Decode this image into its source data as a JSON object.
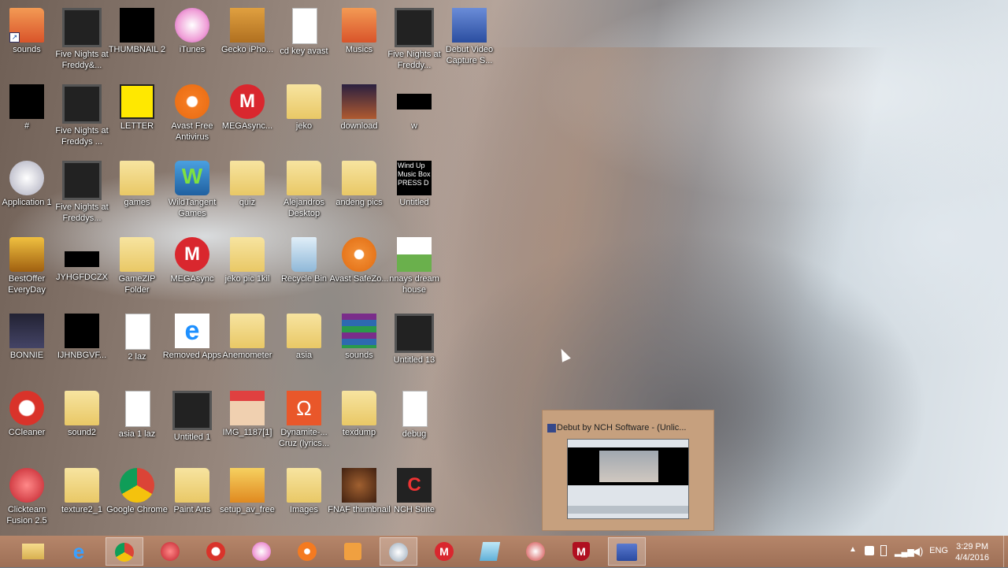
{
  "desktop_icons": [
    {
      "label": "sounds"
    },
    {
      "label": "Five Nights at Freddy&..."
    },
    {
      "label": "THUMBNAIL 2"
    },
    {
      "label": "iTunes"
    },
    {
      "label": "Gecko iPho..."
    },
    {
      "label": "cd key avast"
    },
    {
      "label": "Musics"
    },
    {
      "label": "Five Nights at Freddy..."
    },
    {
      "label": "Debut Video Capture S..."
    },
    {
      "label": "#"
    },
    {
      "label": "Five Nights at Freddys ..."
    },
    {
      "label": "LETTER"
    },
    {
      "label": "Avast Free Antivirus"
    },
    {
      "label": "MEGAsync..."
    },
    {
      "label": "jeko"
    },
    {
      "label": "download"
    },
    {
      "label": "w"
    },
    {
      "label": "Application 1"
    },
    {
      "label": "Five Nights at Freddys..."
    },
    {
      "label": "games"
    },
    {
      "label": "WildTangent Games"
    },
    {
      "label": "quiz"
    },
    {
      "label": "Alejandros Desktop"
    },
    {
      "label": "andeng pics"
    },
    {
      "label": "Untitled"
    },
    {
      "label": "BestOffer EveryDay"
    },
    {
      "label": "JYHGFDCZX"
    },
    {
      "label": "GameZIP Folder"
    },
    {
      "label": "MEGAsync"
    },
    {
      "label": "jeko pic 1kil"
    },
    {
      "label": "Recycle Bin"
    },
    {
      "label": "Avast SafeZo..."
    },
    {
      "label": "nnays dream house"
    },
    {
      "label": "BONNIE"
    },
    {
      "label": "IJHNBGVF..."
    },
    {
      "label": "2 laz"
    },
    {
      "label": "Removed Apps"
    },
    {
      "label": "Anemometer"
    },
    {
      "label": "asia"
    },
    {
      "label": "sounds"
    },
    {
      "label": "Untitled 13"
    },
    {
      "label": "CCleaner"
    },
    {
      "label": "sound2"
    },
    {
      "label": "asia 1 laz"
    },
    {
      "label": "Untitled 1"
    },
    {
      "label": "IMG_1187[1]"
    },
    {
      "label": "Dynamite-... Cruz (lyrics..."
    },
    {
      "label": "texdump"
    },
    {
      "label": "debug"
    },
    {
      "label": "Clickteam Fusion 2.5"
    },
    {
      "label": "texture2_1"
    },
    {
      "label": "Google Chrome"
    },
    {
      "label": "Paint Arts"
    },
    {
      "label": "setup_av_free"
    },
    {
      "label": "Images"
    },
    {
      "label": "FNAF thumbnail"
    },
    {
      "label": "NCH Suite"
    }
  ],
  "thumbnail_texts": {
    "press": "PRESS D",
    "wind": "Wind Up Music Box"
  },
  "taskbar": {
    "apps": [
      "file-explorer",
      "internet-explorer",
      "google-chrome",
      "clickteam-fusion",
      "ccleaner",
      "itunes",
      "avast",
      "debut-video",
      "paint",
      "megasync",
      "notepad",
      "snipping",
      "mcafee",
      "debut-recorder"
    ]
  },
  "preview": {
    "title": "Debut by NCH Software - (Unlic..."
  },
  "tray": {
    "lang": "ENG",
    "time": "3:29 PM",
    "date": "4/4/2016"
  }
}
